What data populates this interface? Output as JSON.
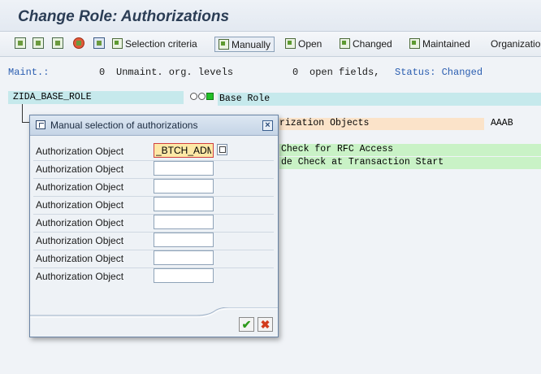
{
  "window": {
    "title": "Change Role: Authorizations"
  },
  "toolbar": {
    "selection_criteria": "Selection criteria",
    "manually": "Manually",
    "open": "Open",
    "changed": "Changed",
    "maintained": "Maintained",
    "organization": "Organizatio"
  },
  "status": {
    "maint_label": "Maint.:",
    "unmaint_count": "0",
    "unmaint_label": "Unmaint. org. levels",
    "open_count": "0",
    "open_label": "open fields,",
    "status_label": "Status: Changed"
  },
  "tree": {
    "role_name": "ZIDA_BASE_ROLE",
    "base_role_text": "Base Role",
    "auth_objects_text": "rization Objects",
    "auth_objects_value": "AAAB",
    "rfc_text": "Check for RFC Access",
    "tcode_text": "de Check at Transaction Start"
  },
  "dialog": {
    "title": "Manual selection of authorizations",
    "field_label": "Authorization Object",
    "rows": [
      {
        "label": "Authorization Object",
        "value": "_BTCH_ADM"
      },
      {
        "label": "Authorization Object",
        "value": ""
      },
      {
        "label": "Authorization Object",
        "value": ""
      },
      {
        "label": "Authorization Object",
        "value": ""
      },
      {
        "label": "Authorization Object",
        "value": ""
      },
      {
        "label": "Authorization Object",
        "value": ""
      },
      {
        "label": "Authorization Object",
        "value": ""
      },
      {
        "label": "Authorization Object",
        "value": ""
      }
    ]
  },
  "colors": {
    "status_blue": "#2a5db0",
    "active_field": "#fde8a6",
    "green_row": "#c9f2c6",
    "orange_row": "#fbe3c9",
    "cyan_row": "#c6e9ec"
  }
}
